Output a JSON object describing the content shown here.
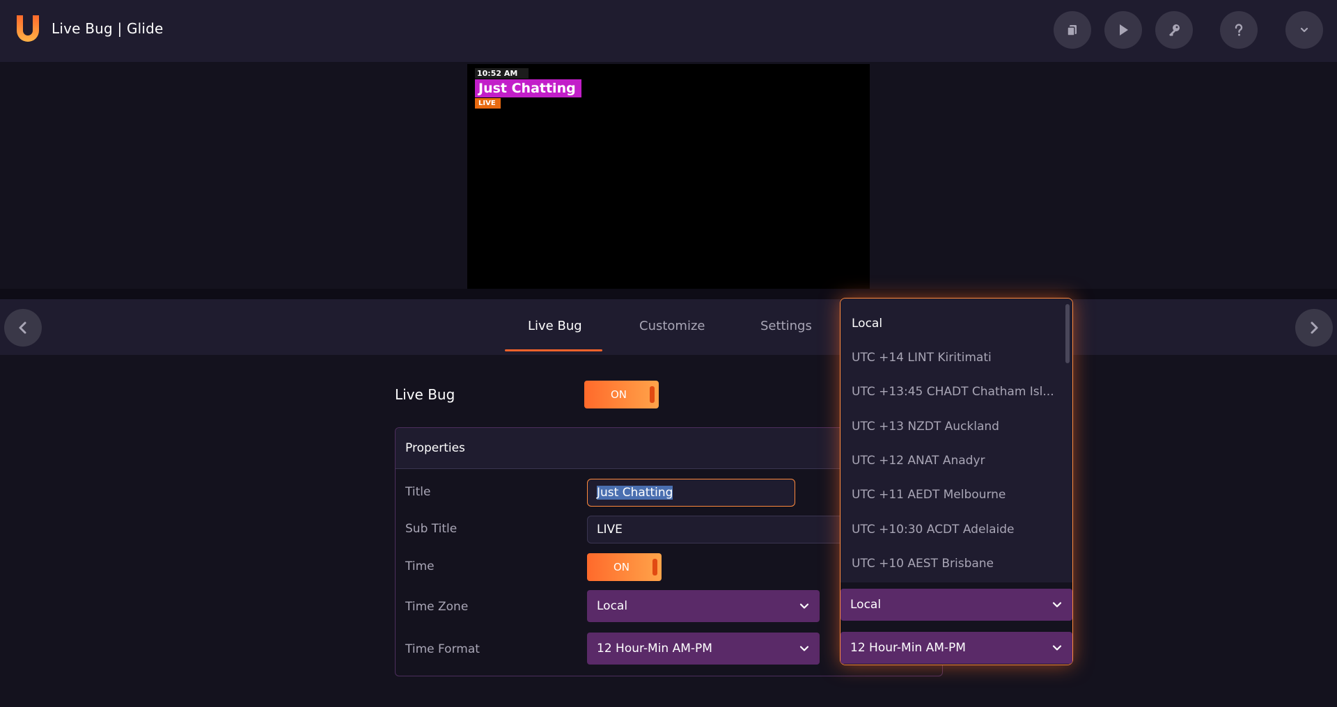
{
  "header": {
    "title": "Live Bug | Glide",
    "logo_icon": "glide-u-logo",
    "buttons": [
      {
        "name": "copy-button",
        "icon": "copy-icon"
      },
      {
        "name": "play-button",
        "icon": "play-icon"
      },
      {
        "name": "key-button",
        "icon": "key-icon"
      },
      {
        "name": "help-button",
        "icon": "help-icon"
      },
      {
        "name": "expand-button",
        "icon": "chevron-down-icon"
      }
    ]
  },
  "preview": {
    "time": "10:52 AM",
    "title": "Just Chatting",
    "subtitle": "LIVE",
    "colors": {
      "title_bg": "#c21ec9",
      "subtitle_bg": "#e86a10"
    }
  },
  "tabs": [
    {
      "label": "Live Bug",
      "active": true
    },
    {
      "label": "Customize",
      "active": false
    },
    {
      "label": "Settings",
      "active": false
    }
  ],
  "livebug": {
    "label": "Live Bug",
    "toggle": "ON"
  },
  "properties": {
    "header": "Properties",
    "title_label": "Title",
    "title_value": "Just Chatting",
    "subtitle_label": "Sub Title",
    "subtitle_value": "LIVE",
    "time_label": "Time",
    "time_toggle": "ON",
    "timezone_label": "Time Zone",
    "timezone_value": "Local",
    "timeformat_label": "Time Format",
    "timeformat_value": "12 Hour-Min AM-PM"
  },
  "dropdown": {
    "options": [
      "Local",
      "UTC +14 LINT Kiritimati",
      "UTC +13:45 CHADT Chatham Isl...",
      "UTC +13 NZDT Auckland",
      "UTC +12 ANAT Anadyr",
      "UTC +11 AEDT Melbourne",
      "UTC +10:30 ACDT Adelaide",
      "UTC +10 AEST Brisbane"
    ],
    "timezone_value": "Local",
    "timeformat_value": "12 Hour-Min AM-PM"
  },
  "colors": {
    "accent": "#ff6a2b",
    "select_bg": "#5a2a68",
    "panel": "#1f1c2f",
    "background": "#14121e"
  }
}
